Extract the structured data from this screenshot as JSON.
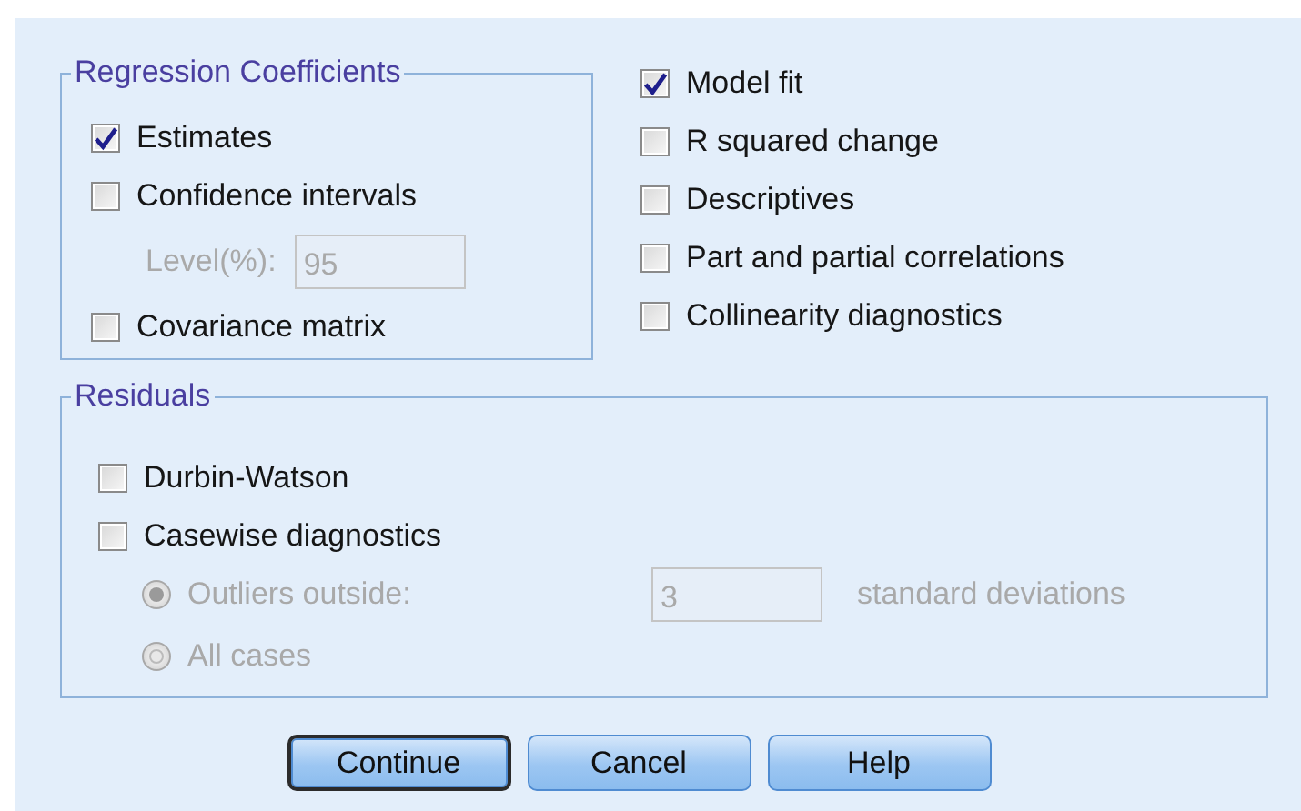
{
  "coefficients": {
    "title": "Regression Coefficients",
    "items": [
      {
        "kind": "checkbox",
        "label": "Estimates",
        "checked": true
      },
      {
        "kind": "checkbox",
        "label": "Confidence intervals",
        "checked": false
      },
      {
        "kind": "field",
        "label": "Level(%):",
        "value": "95",
        "disabled": true
      },
      {
        "kind": "checkbox",
        "label": "Covariance matrix",
        "checked": false
      }
    ]
  },
  "options": [
    {
      "kind": "checkbox",
      "label": "Model fit",
      "checked": true
    },
    {
      "kind": "checkbox",
      "label": "R squared change",
      "checked": false
    },
    {
      "kind": "checkbox",
      "label": "Descriptives",
      "checked": false
    },
    {
      "kind": "checkbox",
      "label": "Part and partial correlations",
      "checked": false
    },
    {
      "kind": "checkbox",
      "label": "Collinearity diagnostics",
      "checked": false
    }
  ],
  "residuals": {
    "title": "Residuals",
    "items": [
      {
        "kind": "checkbox",
        "label": "Durbin-Watson",
        "checked": false
      },
      {
        "kind": "checkbox",
        "label": "Casewise diagnostics",
        "checked": false
      },
      {
        "kind": "radio",
        "label": "Outliers outside:",
        "selected": true,
        "disabled": true,
        "value": "3",
        "suffix": "standard deviations"
      },
      {
        "kind": "radio",
        "label": "All cases",
        "selected": false,
        "disabled": true
      }
    ]
  },
  "buttons": [
    {
      "label": "Continue",
      "default": true
    },
    {
      "label": "Cancel",
      "default": false
    },
    {
      "label": "Help",
      "default": false
    }
  ]
}
